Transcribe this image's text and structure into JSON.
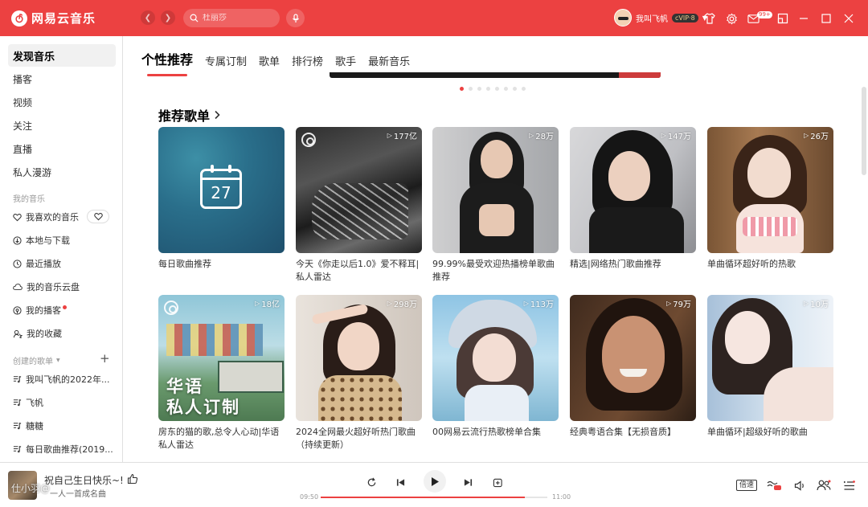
{
  "app": {
    "name": "网易云音乐",
    "search_placeholder": "杜丽莎",
    "username": "我叫飞帆",
    "vip_label": "cVIP·8",
    "mail_badge": "99+",
    "accent": "#ec4141"
  },
  "sidebar": {
    "main_items": [
      "发现音乐",
      "播客",
      "视频",
      "关注",
      "直播",
      "私人漫游"
    ],
    "my_music_title": "我的音乐",
    "my_music": [
      "我喜欢的音乐",
      "本地与下载",
      "最近播放",
      "我的音乐云盘",
      "我的播客",
      "我的收藏"
    ],
    "created_title": "创建的歌单",
    "created": [
      "我叫飞帆的2022年...",
      "飞帆",
      "糖糖",
      "每日歌曲推荐(2019..."
    ]
  },
  "tabs": [
    "个性推荐",
    "专属订制",
    "歌单",
    "排行榜",
    "歌手",
    "最新音乐"
  ],
  "section_title": "推荐歌单",
  "calendar_day": "27",
  "huayu_line1": "华语",
  "huayu_line2": "私人订制",
  "playlists": [
    {
      "title": "每日歌曲推荐",
      "plays": ""
    },
    {
      "title": "今天《你走以后1.0》爱不释耳|私人雷达",
      "plays": "177亿"
    },
    {
      "title": "99.99%最受欢迎热播榜单歌曲推荐",
      "plays": "28万"
    },
    {
      "title": "精选|网络热门歌曲推荐",
      "plays": "147万"
    },
    {
      "title": "单曲循环超好听的热歌",
      "plays": "26万"
    },
    {
      "title": "房东的猫的歌,总令人心动|华语私人雷达",
      "plays": "18亿"
    },
    {
      "title": "2024全网最火超好听热门歌曲（持续更新）",
      "plays": "298万"
    },
    {
      "title": "00网易云流行热歌榜单合集",
      "plays": "113万"
    },
    {
      "title": "经典粤语合集【无损音质】",
      "plays": "79万"
    },
    {
      "title": "单曲循环|超级好听的歌曲",
      "plays": "10万"
    }
  ],
  "player": {
    "song": "祝自己生日快乐~!",
    "artist": "一人一首成名曲",
    "watermark": "仕小羽@ ​",
    "current_time": "09:50",
    "total_time": "11:00",
    "progress": 0.9,
    "speed_label": "倍速"
  }
}
